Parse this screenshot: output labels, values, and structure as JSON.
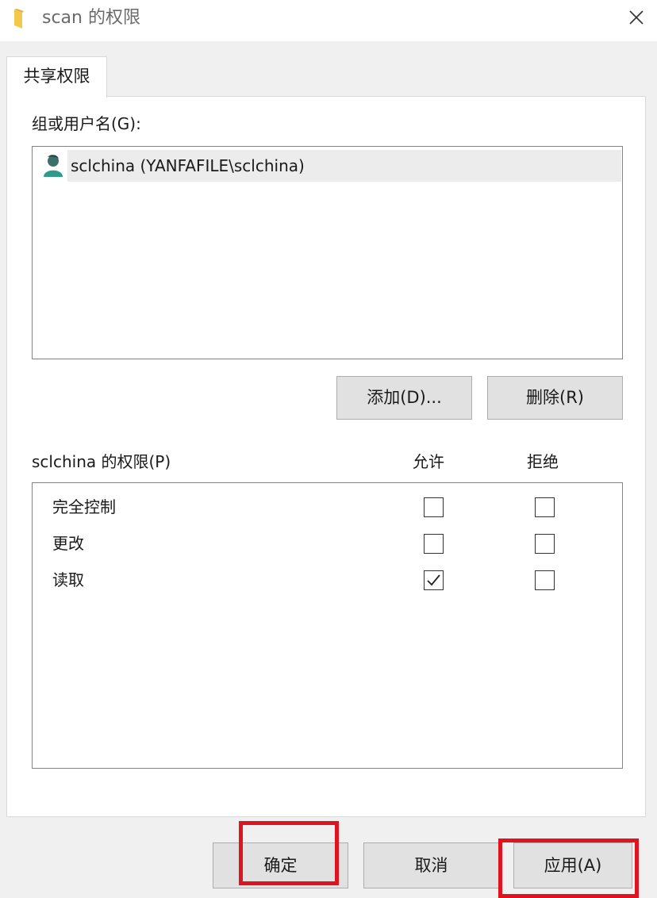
{
  "window": {
    "title": "scan 的权限",
    "folder_icon": "folder-icon",
    "close_icon": "close-icon"
  },
  "tab": {
    "label": "共享权限"
  },
  "groups": {
    "label": "组或用户名(G):",
    "users": [
      {
        "name": "sclchina (YANFAFILE\\sclchina)",
        "icon": "user-icon",
        "selected": true
      }
    ]
  },
  "buttons": {
    "add": "添加(D)...",
    "remove": "删除(R)",
    "ok": "确定",
    "cancel": "取消",
    "apply": "应用(A)"
  },
  "permissions": {
    "label": "sclchina 的权限(P)",
    "allow_header": "允许",
    "deny_header": "拒绝",
    "rows": [
      {
        "name": "完全控制",
        "allow": false,
        "deny": false
      },
      {
        "name": "更改",
        "allow": false,
        "deny": false
      },
      {
        "name": "读取",
        "allow": true,
        "deny": false
      }
    ]
  },
  "colors": {
    "highlight": "#e0141e",
    "selection": "#ececec",
    "folder": "#f2c94c"
  }
}
